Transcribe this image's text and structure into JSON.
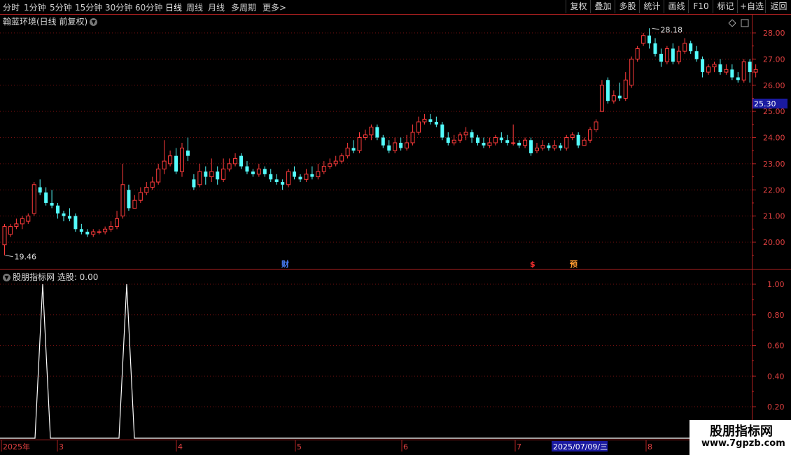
{
  "toolbar": {
    "timeframes": [
      {
        "label": "分时"
      },
      {
        "label": "1分钟"
      },
      {
        "label": "5分钟"
      },
      {
        "label": "15分钟"
      },
      {
        "label": "30分钟"
      },
      {
        "label": "60分钟"
      },
      {
        "label": "日线"
      },
      {
        "label": "周线"
      },
      {
        "label": "月线"
      },
      {
        "label": "多周期"
      },
      {
        "label": "更多"
      }
    ],
    "active_timeframe": "日线",
    "more_arrow": ">",
    "buttons": [
      {
        "label": "复权"
      },
      {
        "label": "叠加"
      },
      {
        "label": "多股"
      },
      {
        "label": "统计"
      },
      {
        "label": "画线"
      },
      {
        "label": "F10"
      },
      {
        "label": "标记"
      },
      {
        "label": "+自选"
      },
      {
        "label": "返回"
      }
    ]
  },
  "main_panel": {
    "title": "翰蓝环境(日线 前复权)",
    "high_label": "28.18",
    "low_label": "19.46",
    "current_price": "25.30",
    "price_ticks": [
      "28.00",
      "27.00",
      "26.00",
      "25.00",
      "24.00",
      "23.00",
      "22.00",
      "21.00",
      "20.00"
    ],
    "markers": [
      {
        "label": "财",
        "color": "#4a80ff"
      },
      {
        "label": "$",
        "color": "#ff3030"
      },
      {
        "label": "预",
        "color": "#ff9a30"
      }
    ]
  },
  "sub_panel": {
    "title": "股朋指标网 选股: 0.00",
    "ticks": [
      "1.00",
      "0.80",
      "0.60",
      "0.40",
      "0.20"
    ]
  },
  "date_axis": {
    "labels": [
      "2025年",
      "3",
      "4",
      "5",
      "6",
      "7",
      "8"
    ],
    "highlight": "2025/07/09/三"
  },
  "watermark": {
    "line1": "股朋指标网",
    "line2": "www.7gpzb.com"
  },
  "colors": {
    "up": "#ff3b3b",
    "down": "#54fcfc",
    "grid": "#7a1010",
    "axis": "#b02020",
    "highlight_bg": "#1a1aa0"
  },
  "chart_data": {
    "type": "candlestick",
    "y_range": [
      19.2,
      28.6
    ],
    "candles": [
      [
        19.9,
        20.6,
        20.7,
        19.5
      ],
      [
        20.3,
        20.6,
        20.7,
        20.2
      ],
      [
        20.6,
        20.7,
        20.9,
        20.5
      ],
      [
        20.7,
        20.9,
        21.0,
        20.5
      ],
      [
        20.8,
        21.0,
        21.1,
        20.7
      ],
      [
        21.1,
        22.2,
        22.3,
        21.0
      ],
      [
        22.1,
        21.9,
        22.4,
        21.8
      ],
      [
        21.9,
        21.5,
        22.1,
        21.4
      ],
      [
        21.5,
        21.4,
        22.0,
        21.3
      ],
      [
        21.4,
        21.1,
        21.5,
        20.9
      ],
      [
        21.1,
        21.0,
        21.2,
        20.8
      ],
      [
        21.0,
        20.9,
        21.3,
        20.8
      ],
      [
        21.0,
        20.5,
        21.1,
        20.4
      ],
      [
        20.5,
        20.4,
        20.7,
        20.3
      ],
      [
        20.4,
        20.3,
        20.5,
        20.2
      ],
      [
        20.3,
        20.4,
        20.5,
        20.2
      ],
      [
        20.4,
        20.4,
        20.5,
        20.3
      ],
      [
        20.4,
        20.5,
        20.6,
        20.3
      ],
      [
        20.5,
        20.6,
        20.8,
        20.4
      ],
      [
        20.6,
        20.9,
        21.2,
        20.5
      ],
      [
        21.0,
        22.2,
        23.0,
        20.9
      ],
      [
        22.0,
        21.3,
        22.2,
        21.2
      ],
      [
        21.3,
        21.6,
        21.8,
        21.3
      ],
      [
        21.6,
        21.9,
        22.1,
        21.5
      ],
      [
        21.9,
        22.1,
        22.3,
        21.8
      ],
      [
        22.1,
        22.3,
        22.5,
        22.0
      ],
      [
        22.3,
        22.8,
        23.0,
        22.2
      ],
      [
        22.8,
        23.1,
        23.9,
        22.6
      ],
      [
        23.0,
        23.3,
        23.5,
        22.9
      ],
      [
        23.3,
        22.7,
        23.6,
        22.6
      ],
      [
        22.7,
        23.6,
        23.8,
        22.5
      ],
      [
        23.5,
        23.3,
        24.0,
        23.1
      ],
      [
        22.4,
        22.1,
        22.6,
        22.0
      ],
      [
        22.2,
        22.7,
        23.0,
        22.1
      ],
      [
        22.7,
        22.5,
        22.9,
        22.2
      ],
      [
        22.5,
        22.7,
        23.2,
        22.3
      ],
      [
        22.7,
        22.4,
        22.9,
        22.2
      ],
      [
        22.4,
        22.8,
        23.2,
        22.3
      ],
      [
        22.8,
        23.0,
        23.2,
        22.7
      ],
      [
        23.0,
        23.2,
        23.4,
        22.9
      ],
      [
        23.3,
        22.9,
        23.4,
        22.8
      ],
      [
        22.9,
        22.7,
        23.1,
        22.6
      ],
      [
        22.7,
        22.6,
        22.8,
        22.5
      ],
      [
        22.6,
        22.8,
        23.0,
        22.5
      ],
      [
        22.8,
        22.6,
        22.9,
        22.5
      ],
      [
        22.6,
        22.4,
        22.8,
        22.3
      ],
      [
        22.4,
        22.3,
        22.6,
        22.2
      ],
      [
        22.3,
        22.2,
        22.4,
        22.0
      ],
      [
        22.2,
        22.7,
        22.8,
        22.1
      ],
      [
        22.7,
        22.5,
        22.9,
        22.4
      ],
      [
        22.5,
        22.4,
        22.6,
        22.3
      ],
      [
        22.4,
        22.6,
        22.8,
        22.3
      ],
      [
        22.6,
        22.5,
        22.9,
        22.4
      ],
      [
        22.5,
        22.7,
        23.0,
        22.4
      ],
      [
        22.7,
        22.9,
        23.1,
        22.6
      ],
      [
        22.9,
        23.0,
        23.2,
        22.8
      ],
      [
        23.0,
        23.1,
        23.3,
        22.9
      ],
      [
        23.1,
        23.3,
        23.4,
        23.0
      ],
      [
        23.3,
        23.6,
        23.8,
        23.2
      ],
      [
        23.6,
        23.5,
        23.9,
        23.4
      ],
      [
        23.5,
        24.0,
        24.2,
        23.4
      ],
      [
        24.0,
        24.1,
        24.3,
        23.9
      ],
      [
        24.1,
        24.4,
        24.5,
        23.9
      ],
      [
        24.4,
        24.0,
        24.5,
        23.9
      ],
      [
        24.0,
        23.7,
        24.1,
        23.6
      ],
      [
        23.7,
        23.5,
        23.9,
        23.4
      ],
      [
        23.5,
        23.8,
        24.0,
        23.4
      ],
      [
        23.8,
        23.6,
        24.0,
        23.5
      ],
      [
        23.6,
        23.8,
        24.1,
        23.5
      ],
      [
        23.8,
        24.2,
        24.5,
        23.7
      ],
      [
        24.2,
        24.6,
        24.8,
        24.1
      ],
      [
        24.6,
        24.7,
        24.9,
        24.5
      ],
      [
        24.7,
        24.6,
        24.9,
        24.5
      ],
      [
        24.6,
        24.5,
        24.8,
        24.4
      ],
      [
        24.5,
        24.0,
        24.6,
        23.9
      ],
      [
        24.0,
        23.8,
        24.2,
        23.7
      ],
      [
        23.8,
        23.9,
        24.1,
        23.7
      ],
      [
        23.9,
        24.1,
        24.2,
        23.8
      ],
      [
        24.1,
        24.2,
        24.4,
        23.9
      ],
      [
        24.2,
        24.0,
        24.3,
        23.8
      ],
      [
        24.0,
        23.8,
        24.1,
        23.7
      ],
      [
        23.8,
        23.7,
        24.0,
        23.6
      ],
      [
        23.7,
        23.8,
        24.0,
        23.6
      ],
      [
        23.8,
        24.0,
        24.1,
        23.7
      ],
      [
        24.0,
        23.9,
        24.2,
        23.8
      ],
      [
        23.9,
        23.8,
        24.1,
        23.7
      ],
      [
        23.8,
        23.8,
        24.5,
        23.7
      ],
      [
        23.8,
        23.7,
        23.9,
        23.6
      ],
      [
        23.7,
        23.9,
        24.0,
        23.6
      ],
      [
        23.9,
        23.4,
        24.0,
        23.3
      ],
      [
        23.5,
        23.6,
        23.8,
        23.4
      ],
      [
        23.6,
        23.7,
        23.9,
        23.5
      ],
      [
        23.7,
        23.6,
        23.8,
        23.5
      ],
      [
        23.6,
        23.7,
        23.9,
        23.5
      ],
      [
        23.7,
        23.6,
        23.8,
        23.5
      ],
      [
        23.6,
        24.0,
        24.1,
        23.5
      ],
      [
        24.0,
        24.1,
        24.2,
        23.9
      ],
      [
        24.1,
        23.7,
        24.2,
        23.6
      ],
      [
        23.7,
        23.9,
        24.0,
        23.7
      ],
      [
        23.9,
        24.3,
        24.4,
        23.8
      ],
      [
        24.3,
        24.6,
        24.7,
        24.2
      ],
      [
        25.0,
        26.0,
        26.2,
        25.0
      ],
      [
        26.2,
        25.4,
        26.3,
        25.3
      ],
      [
        25.4,
        25.6,
        25.8,
        25.3
      ],
      [
        25.6,
        25.5,
        26.1,
        25.4
      ],
      [
        25.5,
        26.2,
        26.5,
        25.4
      ],
      [
        26.0,
        27.0,
        27.1,
        25.9
      ],
      [
        27.0,
        27.4,
        27.5,
        26.9
      ],
      [
        27.6,
        27.9,
        28.0,
        27.5
      ],
      [
        27.9,
        27.6,
        28.18,
        27.4
      ],
      [
        27.6,
        27.2,
        27.8,
        27.1
      ],
      [
        27.2,
        26.9,
        27.4,
        26.7
      ],
      [
        26.9,
        27.4,
        27.5,
        26.8
      ],
      [
        27.4,
        26.9,
        27.6,
        26.8
      ],
      [
        26.9,
        27.3,
        27.5,
        26.8
      ],
      [
        27.3,
        27.6,
        27.8,
        27.2
      ],
      [
        27.6,
        27.3,
        27.7,
        27.2
      ],
      [
        27.3,
        27.0,
        27.5,
        26.9
      ],
      [
        27.0,
        26.5,
        27.1,
        26.3
      ],
      [
        26.5,
        26.7,
        26.8,
        26.4
      ],
      [
        26.7,
        26.8,
        26.9,
        26.5
      ],
      [
        26.8,
        26.5,
        27.0,
        26.4
      ],
      [
        26.5,
        26.6,
        26.8,
        26.4
      ],
      [
        26.6,
        26.3,
        26.8,
        26.2
      ],
      [
        26.3,
        26.2,
        26.5,
        26.1
      ],
      [
        26.2,
        26.9,
        27.0,
        26.1
      ],
      [
        26.9,
        26.5,
        27.0,
        26.1
      ],
      [
        26.5,
        26.6,
        26.8,
        26.3
      ]
    ],
    "signal_series": {
      "name": "选股",
      "peaks_at_index": [
        8,
        22
      ],
      "values_range": [
        0,
        1
      ]
    }
  }
}
